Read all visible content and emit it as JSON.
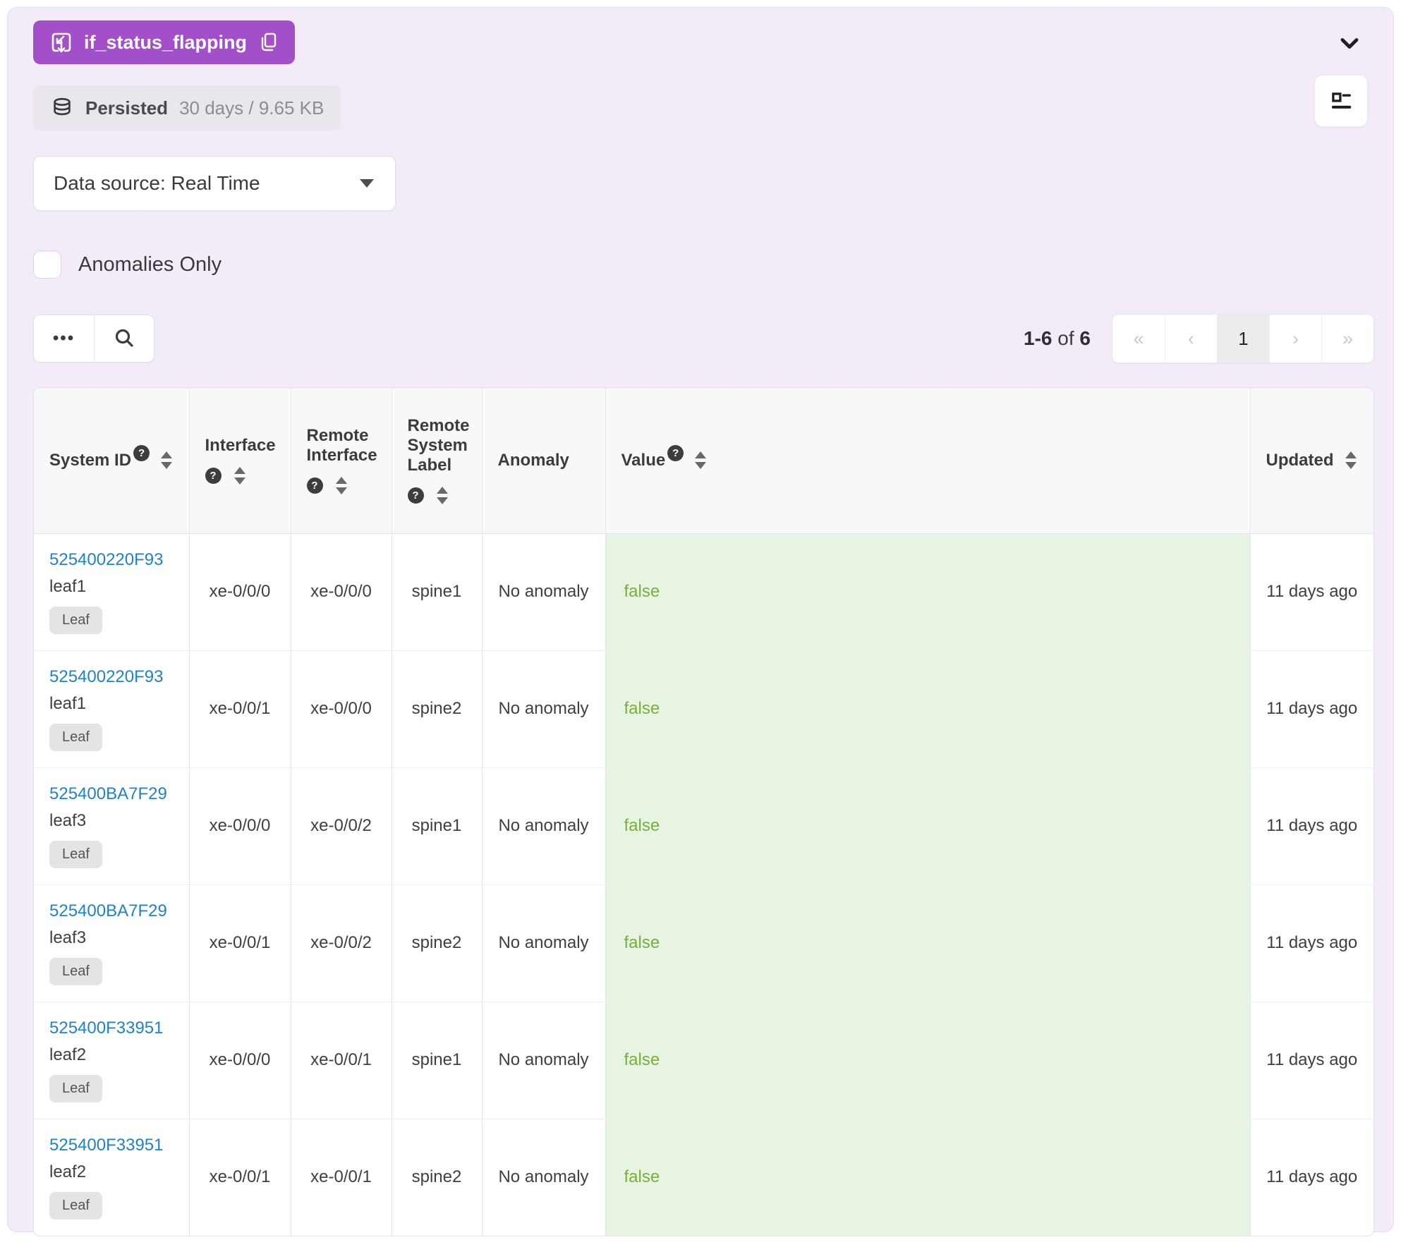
{
  "probe": {
    "name": "if_status_flapping",
    "persisted_label": "Persisted",
    "persisted_detail": "30 days / 9.65 KB",
    "datasource": "Data source: Real Time",
    "anomalies_only_label": "Anomalies Only"
  },
  "icons": {
    "help": "?",
    "more": "•••",
    "first": "«",
    "prev": "‹",
    "next": "›",
    "last": "»"
  },
  "pagination": {
    "range_start": "1-6",
    "range_sep": " of ",
    "range_total": "6",
    "current_page": "1"
  },
  "table": {
    "columns": [
      {
        "label": "System ID"
      },
      {
        "label": "Interface"
      },
      {
        "label": "Remote Interface"
      },
      {
        "label": "Remote System Label"
      },
      {
        "label": "Anomaly"
      },
      {
        "label": "Value"
      },
      {
        "label": "Updated"
      }
    ],
    "rows": [
      {
        "system_id": "525400220F93",
        "hostname": "leaf1",
        "role": "Leaf",
        "interface": "xe-0/0/0",
        "remote_interface": "xe-0/0/0",
        "remote_system_label": "spine1",
        "anomaly": "No anomaly",
        "value": "false",
        "updated": "11 days ago"
      },
      {
        "system_id": "525400220F93",
        "hostname": "leaf1",
        "role": "Leaf",
        "interface": "xe-0/0/1",
        "remote_interface": "xe-0/0/0",
        "remote_system_label": "spine2",
        "anomaly": "No anomaly",
        "value": "false",
        "updated": "11 days ago"
      },
      {
        "system_id": "525400BA7F29",
        "hostname": "leaf3",
        "role": "Leaf",
        "interface": "xe-0/0/0",
        "remote_interface": "xe-0/0/2",
        "remote_system_label": "spine1",
        "anomaly": "No anomaly",
        "value": "false",
        "updated": "11 days ago"
      },
      {
        "system_id": "525400BA7F29",
        "hostname": "leaf3",
        "role": "Leaf",
        "interface": "xe-0/0/1",
        "remote_interface": "xe-0/0/2",
        "remote_system_label": "spine2",
        "anomaly": "No anomaly",
        "value": "false",
        "updated": "11 days ago"
      },
      {
        "system_id": "525400F33951",
        "hostname": "leaf2",
        "role": "Leaf",
        "interface": "xe-0/0/0",
        "remote_interface": "xe-0/0/1",
        "remote_system_label": "spine1",
        "anomaly": "No anomaly",
        "value": "false",
        "updated": "11 days ago"
      },
      {
        "system_id": "525400F33951",
        "hostname": "leaf2",
        "role": "Leaf",
        "interface": "xe-0/0/1",
        "remote_interface": "xe-0/0/1",
        "remote_system_label": "spine2",
        "anomaly": "No anomaly",
        "value": "false",
        "updated": "11 days ago"
      }
    ]
  },
  "colors": {
    "accent": "#a34fc9",
    "link": "#2083c5",
    "value-bg": "#e6f4e1",
    "value-text": "#79af3d",
    "card-bg": "#f3ecf8"
  }
}
